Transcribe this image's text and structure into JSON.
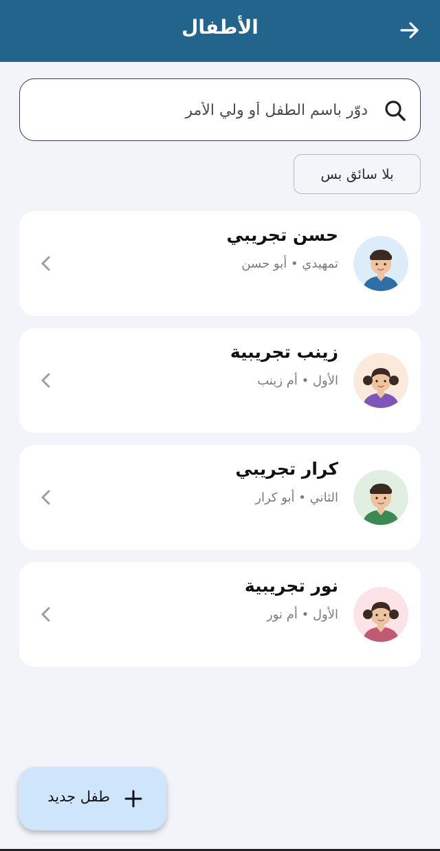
{
  "header": {
    "title": "الأطفال",
    "back_icon": "arrow-right-icon",
    "background": "#23648c"
  },
  "search": {
    "placeholder": "دوّر باسم الطفل أو ولي الأمر",
    "icon": "search-icon"
  },
  "filter": {
    "label": "بلا سائق بس"
  },
  "children": [
    {
      "name": "حسن تجريبي",
      "subtitle": "تمهيدي • أبو حسن",
      "avatar": "boy",
      "avatar_bg": "#dcecf8",
      "shirt": "#2f6fa6"
    },
    {
      "name": "زينب تجريبية",
      "subtitle": "الأول • أم زينب",
      "avatar": "girl",
      "avatar_bg": "#fbeadc",
      "shirt": "#7f55b8"
    },
    {
      "name": "كرار تجريبي",
      "subtitle": "الثاني • أبو كرار",
      "avatar": "boy",
      "avatar_bg": "#e0efe2",
      "shirt": "#3c8a53"
    },
    {
      "name": "نور تجريبية",
      "subtitle": "الأول • أم نور",
      "avatar": "girl",
      "avatar_bg": "#fbe3e7",
      "shirt": "#bf5a72"
    }
  ],
  "fab": {
    "label": "طفل جديد",
    "icon": "plus-icon",
    "background": "#cfe5fb"
  }
}
